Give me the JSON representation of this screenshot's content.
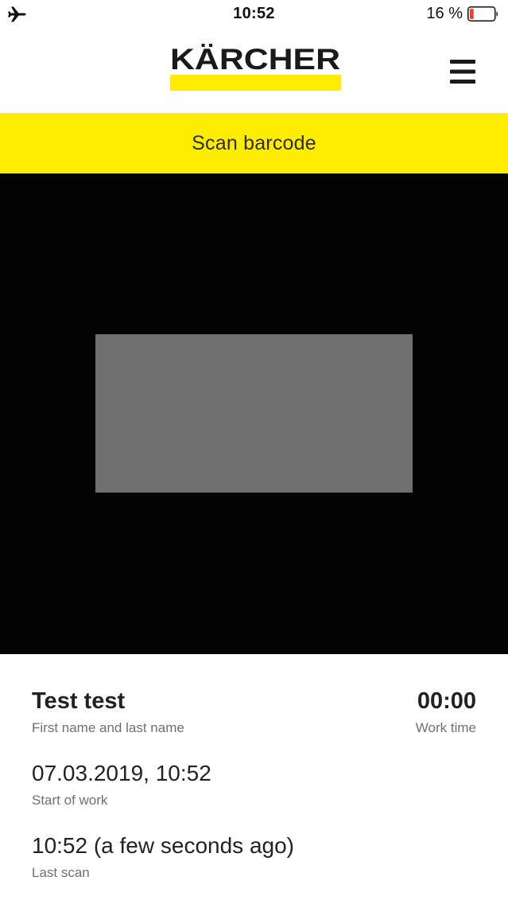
{
  "status_bar": {
    "time": "10:52",
    "battery_percent": "16 %",
    "battery_level": 0.16,
    "battery_color": "#ff3b30",
    "airplane_icon": "airplane-icon"
  },
  "header": {
    "logo_text": "KÄRCHER",
    "brand_yellow": "#ffed00",
    "menu_icon": "hamburger-menu-icon"
  },
  "title_bar": {
    "title": "Scan barcode"
  },
  "info": {
    "name_value": "Test test",
    "name_label": "First name and last name",
    "work_time_value": "00:00",
    "work_time_label": "Work time",
    "start_value": "07.03.2019, 10:52",
    "start_label": "Start of work",
    "last_scan_value": "10:52 (a few seconds ago)",
    "last_scan_label": "Last scan"
  }
}
